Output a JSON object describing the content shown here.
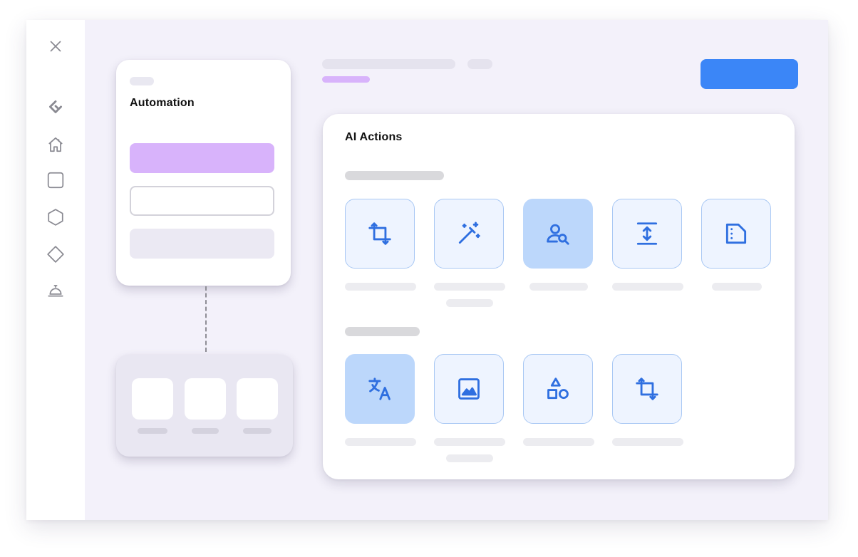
{
  "sidebar": {
    "icons": [
      {
        "name": "close-icon"
      },
      {
        "name": "logo-icon"
      },
      {
        "name": "home-icon"
      },
      {
        "name": "square-icon"
      },
      {
        "name": "hexagon-icon"
      },
      {
        "name": "diamond-icon"
      },
      {
        "name": "service-bell-icon"
      }
    ]
  },
  "automation_card": {
    "title": "Automation"
  },
  "ai_actions": {
    "title": "AI Actions",
    "row1": [
      {
        "icon": "crop-icon",
        "active": false
      },
      {
        "icon": "magic-wand-icon",
        "active": false
      },
      {
        "icon": "person-search-icon",
        "active": true
      },
      {
        "icon": "vertical-resize-icon",
        "active": false
      },
      {
        "icon": "document-icon",
        "active": false
      }
    ],
    "row2": [
      {
        "icon": "translate-icon",
        "active": true
      },
      {
        "icon": "image-icon",
        "active": false
      },
      {
        "icon": "shapes-icon",
        "active": false
      },
      {
        "icon": "crop-icon",
        "active": false
      }
    ]
  },
  "colors": {
    "accent_blue": "#3b86f7",
    "icon_blue": "#2f6fe0",
    "purple_accent": "#d8b3fb",
    "tile_fill": "#eef4ff",
    "tile_active_fill": "#bcd7fb",
    "background": "#f3f1fa"
  }
}
